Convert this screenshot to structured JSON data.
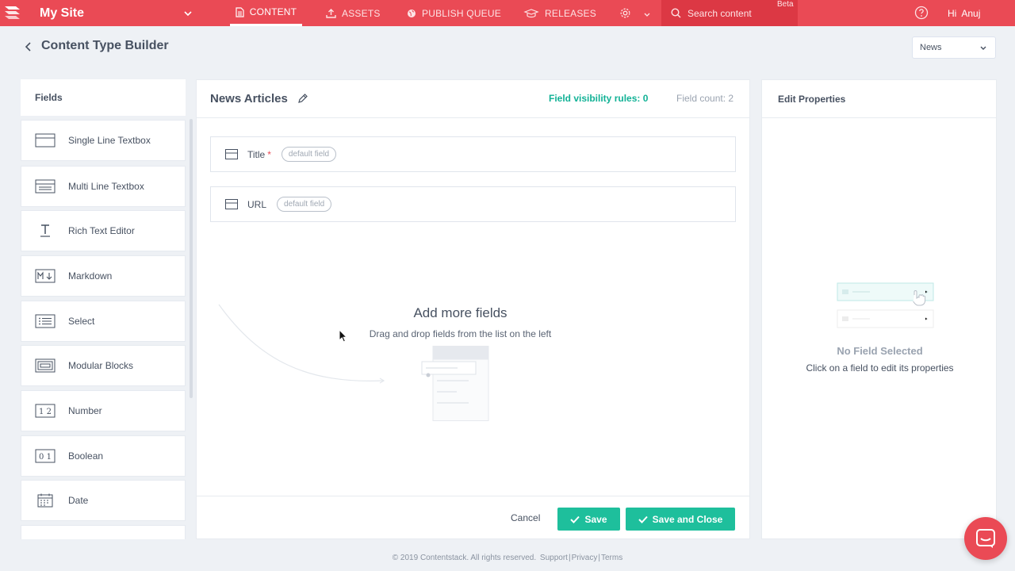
{
  "topbar": {
    "site_name": "My Site",
    "nav": [
      {
        "label": "CONTENT",
        "icon": "document-icon",
        "active": true
      },
      {
        "label": "ASSETS",
        "icon": "upload-icon",
        "active": false
      },
      {
        "label": "PUBLISH QUEUE",
        "icon": "globe-icon",
        "active": false
      },
      {
        "label": "RELEASES",
        "icon": "releases-icon",
        "active": false
      }
    ],
    "search_placeholder": "Search content",
    "beta_label": "Beta",
    "greeting": "Hi  Anuj",
    "accent_color": "#ea4a55"
  },
  "page": {
    "title": "Content Type Builder",
    "stack_select": "News"
  },
  "fields_panel": {
    "title": "Fields",
    "items": [
      {
        "label": "Single Line Textbox",
        "icon": "single-line-icon"
      },
      {
        "label": "Multi Line Textbox",
        "icon": "multi-line-icon"
      },
      {
        "label": "Rich Text Editor",
        "icon": "rich-text-icon"
      },
      {
        "label": "Markdown",
        "icon": "markdown-icon"
      },
      {
        "label": "Select",
        "icon": "select-list-icon"
      },
      {
        "label": "Modular Blocks",
        "icon": "modular-blocks-icon"
      },
      {
        "label": "Number",
        "icon": "number-icon"
      },
      {
        "label": "Boolean",
        "icon": "boolean-icon"
      },
      {
        "label": "Date",
        "icon": "calendar-icon"
      }
    ]
  },
  "builder": {
    "content_type_name": "News Articles",
    "visibility_rules": "Field visibility rules: 0",
    "field_count": "Field count: 2",
    "schema": [
      {
        "label": "Title",
        "required": "*",
        "tag": "default field"
      },
      {
        "label": "URL",
        "required": "",
        "tag": "default field"
      }
    ],
    "empty_title": "Add more fields",
    "empty_subtitle": "Drag and drop fields from the list on the left",
    "cancel_label": "Cancel",
    "save_label": "Save",
    "save_close_label": "Save and Close",
    "save_color": "#1ebf9c"
  },
  "properties": {
    "title": "Edit Properties",
    "empty_title": "No Field Selected",
    "empty_subtitle": "Click on a field to edit its properties"
  },
  "footer": {
    "copyright": "© 2019 Contentstack. All rights reserved.",
    "support": "Support",
    "privacy": "Privacy",
    "terms": "Terms"
  }
}
